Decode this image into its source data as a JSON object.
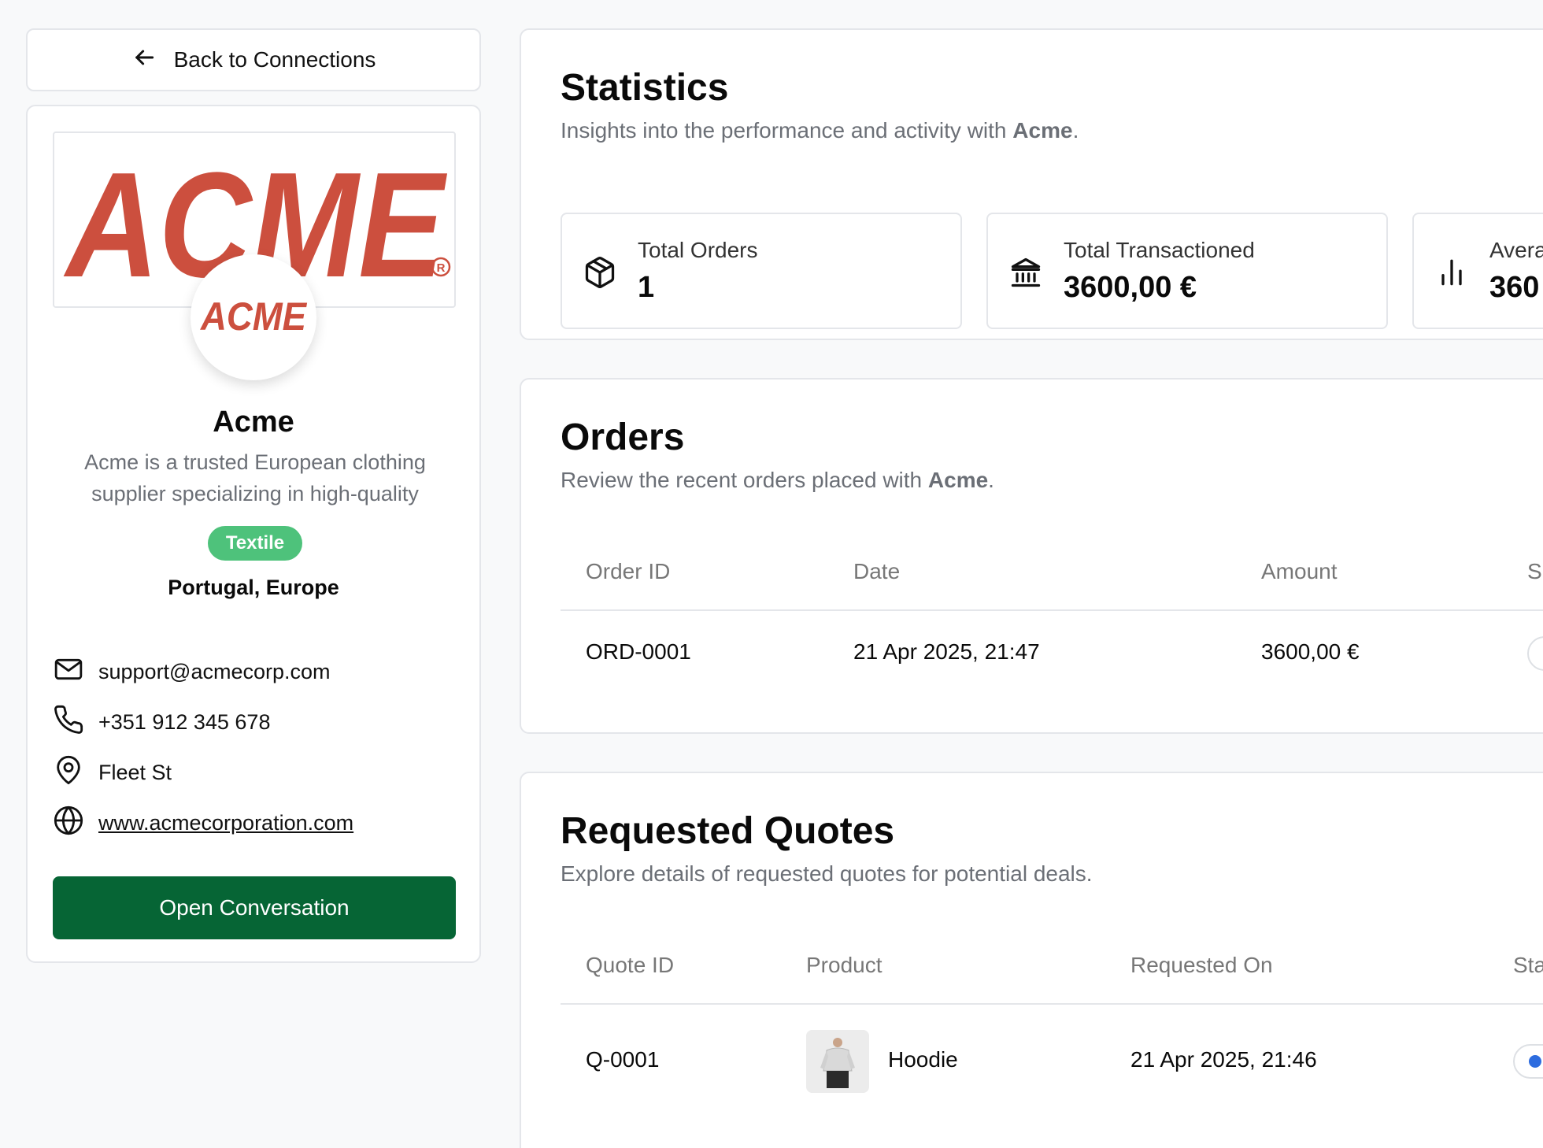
{
  "nav": {
    "back_label": "Back to Connections"
  },
  "profile": {
    "banner_logo_text": "ACME",
    "avatar_logo_text": "ACME",
    "name": "Acme",
    "description": "Acme is a trusted European clothing supplier specializing in high-quality",
    "badge": "Textile",
    "location": "Portugal, Europe",
    "email": "support@acmecorp.com",
    "phone": "+351 912 345 678",
    "address": "Fleet St",
    "website": "www.acmecorporation.com",
    "open_conversation_label": "Open Conversation",
    "brand_color": "#cc4f3e",
    "badge_color": "#4ec27b",
    "button_color": "#066535"
  },
  "statistics": {
    "title": "Statistics",
    "subtitle_prefix": "Insights into the performance and activity with ",
    "subtitle_company": "Acme",
    "subtitle_suffix": ".",
    "cards": [
      {
        "label": "Total Orders",
        "value": "1",
        "icon": "package-icon"
      },
      {
        "label": "Total Transactioned",
        "value": "3600,00 €",
        "icon": "bank-icon"
      },
      {
        "label": "Avera",
        "value": "360",
        "icon": "bar-chart-icon"
      }
    ]
  },
  "orders": {
    "title": "Orders",
    "subtitle_prefix": "Review the recent orders placed with ",
    "subtitle_company": "Acme",
    "subtitle_suffix": ".",
    "columns": [
      "Order ID",
      "Date",
      "Amount",
      "S"
    ],
    "rows": [
      {
        "id": "ORD-0001",
        "date": "21 Apr 2025, 21:47",
        "amount": "3600,00 €"
      }
    ]
  },
  "quotes": {
    "title": "Requested Quotes",
    "subtitle": "Explore details of requested quotes for potential deals.",
    "columns": [
      "Quote ID",
      "Product",
      "Requested On",
      "Sta"
    ],
    "rows": [
      {
        "id": "Q-0001",
        "product": "Hoodie",
        "requested_on": "21 Apr 2025, 21:46"
      }
    ]
  }
}
